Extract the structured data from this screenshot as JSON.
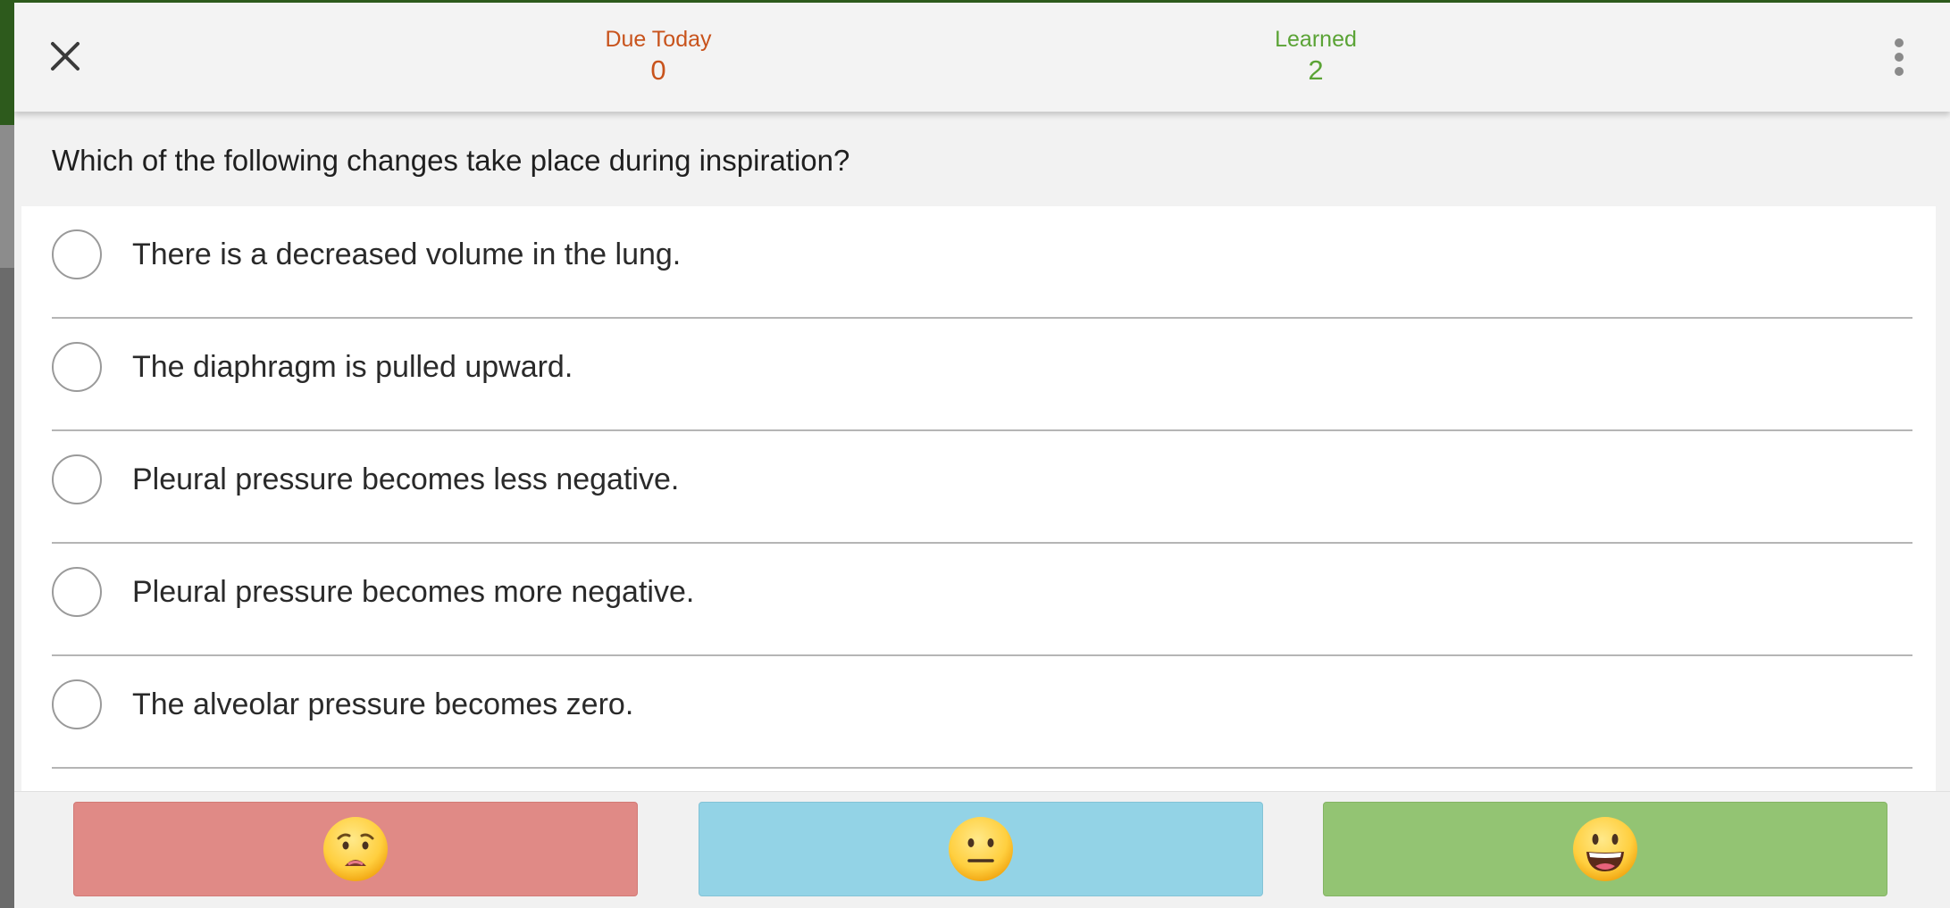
{
  "header": {
    "close_icon": "close-icon",
    "due_today": {
      "label": "Due Today",
      "value": "0",
      "color": "#c8531c"
    },
    "learned": {
      "label": "Learned",
      "value": "2",
      "color": "#5aa335"
    },
    "menu_icon": "vertical-dots-icon"
  },
  "question": {
    "text": "Which of the following changes take place during inspiration?"
  },
  "answers": [
    {
      "text": "There is a decreased volume in the lung."
    },
    {
      "text": "The diaphragm is pulled upward."
    },
    {
      "text": "Pleural pressure becomes less negative."
    },
    {
      "text": "Pleural pressure becomes more negative."
    },
    {
      "text": "The alveolar pressure becomes zero."
    }
  ],
  "rating_buttons": [
    {
      "icon": "worried-face-icon",
      "color": "#e08a86"
    },
    {
      "icon": "neutral-face-icon",
      "color": "#93d3e6"
    },
    {
      "icon": "smiling-face-icon",
      "color": "#93c473"
    }
  ]
}
